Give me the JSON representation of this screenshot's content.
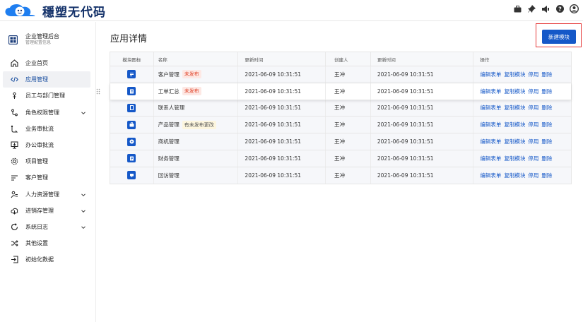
{
  "brand": {
    "logo_text": "穩塑无代码"
  },
  "topbar": {
    "icons": [
      "briefcase-icon",
      "pin-icon",
      "speaker-icon",
      "help-icon",
      "user-icon"
    ]
  },
  "sidebar": {
    "org_title": "企业管理后台",
    "org_subtitle": "管理配置信息",
    "items": [
      {
        "label": "企业首页",
        "icon": "home-icon"
      },
      {
        "label": "应用管理",
        "icon": "code-icon",
        "active": true
      },
      {
        "label": "员工与部门管理",
        "icon": "staff-icon"
      },
      {
        "label": "角色权限管理",
        "icon": "role-icon",
        "expandable": true
      },
      {
        "label": "业务审批流",
        "icon": "flow-icon"
      },
      {
        "label": "办公审批流",
        "icon": "office-icon"
      },
      {
        "label": "项目管理",
        "icon": "gear-icon"
      },
      {
        "label": "客户管理",
        "icon": "customer-icon"
      },
      {
        "label": "人力资源管理",
        "icon": "hr-icon",
        "expandable": true
      },
      {
        "label": "进销存管理",
        "icon": "cloud-icon",
        "expandable": true
      },
      {
        "label": "系统日志",
        "icon": "refresh-icon",
        "expandable": true
      },
      {
        "label": "其他设置",
        "icon": "shuffle-icon"
      },
      {
        "label": "初始化数据",
        "icon": "login-icon"
      }
    ]
  },
  "main": {
    "title": "应用详情",
    "new_button": "新建模块"
  },
  "table": {
    "headers": [
      "模块图标",
      "名称",
      "更新时间",
      "创建人",
      "更新时间",
      "操作"
    ],
    "ops": [
      "编辑表单",
      "复制模块",
      "停用",
      "删除"
    ],
    "rows": [
      {
        "name": "客户管理",
        "badge": "未发布",
        "badge_type": "red",
        "time1": "2021-06-09  10:31:51",
        "creator": "王冲",
        "time2": "2021-06-09  10:31:51"
      },
      {
        "name": "工单汇总",
        "badge": "未发布",
        "badge_type": "red",
        "time1": "2021-06-09  10:31:51",
        "creator": "王冲",
        "time2": "2021-06-09  10:31:51"
      },
      {
        "name": "联系人管理",
        "badge": "",
        "badge_type": "",
        "time1": "2021-06-09  10:31:51",
        "creator": "王冲",
        "time2": "2021-06-09  10:31:51"
      },
      {
        "name": "产品管理",
        "badge": "有未发布更改",
        "badge_type": "yellow",
        "time1": "2021-06-09  10:31:51",
        "creator": "王冲",
        "time2": "2021-06-09  10:31:51"
      },
      {
        "name": "商机管理",
        "badge": "",
        "badge_type": "",
        "time1": "2021-06-09  10:31:51",
        "creator": "王冲",
        "time2": "2021-06-09  10:31:51"
      },
      {
        "name": "财务管理",
        "badge": "",
        "badge_type": "",
        "time1": "2021-06-09  10:31:51",
        "creator": "王冲",
        "time2": "2021-06-09  10:31:51"
      },
      {
        "name": "回访管理",
        "badge": "",
        "badge_type": "",
        "time1": "2021-06-09  10:31:51",
        "creator": "王冲",
        "time2": "2021-06-09  10:31:51"
      }
    ]
  },
  "colors": {
    "primary": "#1558c8",
    "highlight": "#e53a3a",
    "brand": "#14326a"
  }
}
